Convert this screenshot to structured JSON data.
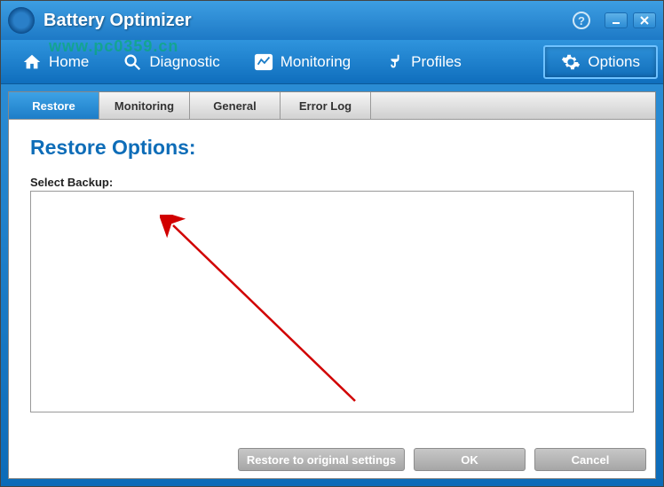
{
  "titlebar": {
    "app_title": "Battery Optimizer"
  },
  "nav": {
    "home": "Home",
    "diagnostic": "Diagnostic",
    "monitoring": "Monitoring",
    "profiles": "Profiles",
    "options": "Options"
  },
  "tabs": {
    "restore": "Restore",
    "monitoring": "Monitoring",
    "general": "General",
    "error_log": "Error Log"
  },
  "panel": {
    "heading": "Restore Options:",
    "select_backup_label": "Select Backup:"
  },
  "buttons": {
    "restore_original": "Restore to original settings",
    "ok": "OK",
    "cancel": "Cancel"
  },
  "watermark": "www.pc0359.cn"
}
